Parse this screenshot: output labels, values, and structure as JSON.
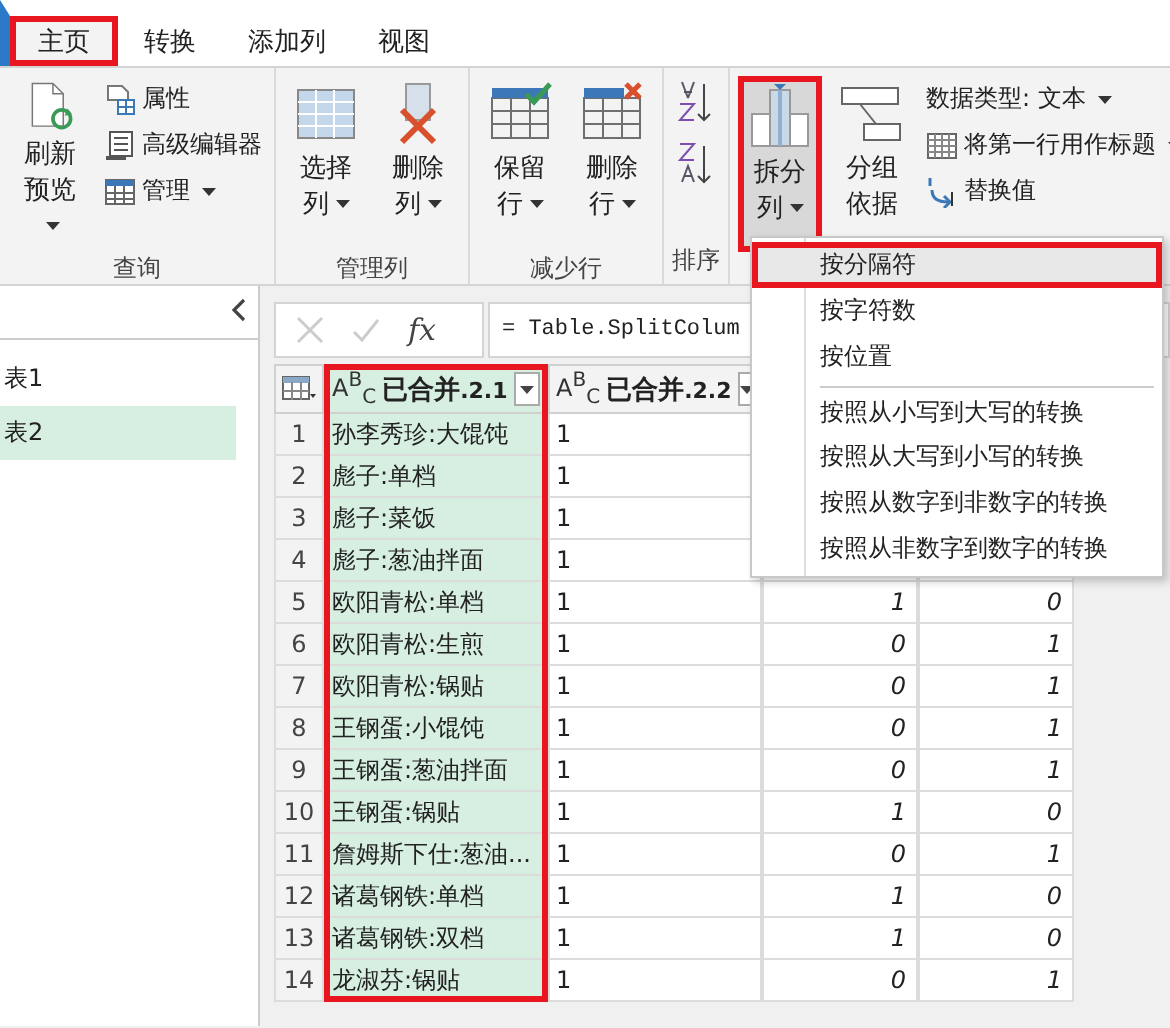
{
  "tabs": [
    {
      "label": "主页",
      "selected": true,
      "highlighted": true
    },
    {
      "label": "转换",
      "selected": false,
      "highlighted": false
    },
    {
      "label": "添加列",
      "selected": false,
      "highlighted": false
    },
    {
      "label": "视图",
      "selected": false,
      "highlighted": false
    }
  ],
  "ribbon": {
    "groups": [
      {
        "label": "查询",
        "items": [
          {
            "kind": "large",
            "lines": [
              "刷新",
              "预览"
            ],
            "dropdown": true,
            "pressed": false,
            "highlighted": false
          },
          {
            "kind": "small",
            "label": "属性",
            "dropdown": false
          },
          {
            "kind": "small",
            "label": "高级编辑器",
            "dropdown": false
          },
          {
            "kind": "small",
            "label": "管理",
            "dropdown": true
          }
        ]
      },
      {
        "label": "管理列",
        "items": [
          {
            "kind": "large",
            "lines": [
              "选择",
              "列"
            ],
            "dropdown": true,
            "pressed": false,
            "highlighted": false
          },
          {
            "kind": "large",
            "lines": [
              "删除",
              "列"
            ],
            "dropdown": true,
            "pressed": false,
            "highlighted": false
          }
        ]
      },
      {
        "label": "减少行",
        "items": [
          {
            "kind": "large",
            "lines": [
              "保留",
              "行"
            ],
            "dropdown": true,
            "pressed": false,
            "highlighted": false
          },
          {
            "kind": "large",
            "lines": [
              "删除",
              "行"
            ],
            "dropdown": true,
            "pressed": false,
            "highlighted": false
          }
        ]
      },
      {
        "label": "排序",
        "items": [
          {
            "kind": "icon"
          },
          {
            "kind": "icon"
          }
        ]
      },
      {
        "items": [
          {
            "kind": "large",
            "lines": [
              "拆分",
              "列"
            ],
            "dropdown": true,
            "pressed": true,
            "highlighted": true
          },
          {
            "kind": "large",
            "lines": [
              "分组",
              "依据"
            ],
            "dropdown": false,
            "pressed": false,
            "highlighted": false
          },
          {
            "kind": "small",
            "label": "数据类型: 文本",
            "dropdown": true
          },
          {
            "kind": "small",
            "label": "将第一行用作标题",
            "dropdown": true
          },
          {
            "kind": "small",
            "label": "替换值",
            "dropdown": false
          }
        ]
      }
    ]
  },
  "queries": {
    "items": [
      {
        "label": "表1",
        "selected": false
      },
      {
        "label": "表2",
        "selected": true
      }
    ]
  },
  "formula_bar": {
    "fx": "fx",
    "formula": "= Table.SplitColum"
  },
  "table": {
    "columns": [
      {
        "type": "A$^{B}$$_{C}$",
        "name": "已合并",
        "suffix": ".2.1",
        "selected": true,
        "highlighted": true
      },
      {
        "type": "A$^{B}$$_{C}$",
        "name": "已合并",
        "suffix": ".2.2",
        "selected": false,
        "highlighted": false
      }
    ],
    "rows": [
      {
        "num": "1",
        "cells": [
          "孙李秀珍:大馄饨",
          "1"
        ]
      },
      {
        "num": "2",
        "cells": [
          "彪子:单档",
          "1"
        ]
      },
      {
        "num": "3",
        "cells": [
          "彪子:菜饭",
          "1"
        ]
      },
      {
        "num": "4",
        "cells": [
          "彪子:葱油拌面",
          "1"
        ]
      },
      {
        "num": "5",
        "cells": [
          "欧阳青松:单档",
          "1",
          "1",
          "0"
        ]
      },
      {
        "num": "6",
        "cells": [
          "欧阳青松:生煎",
          "1",
          "0",
          "1"
        ]
      },
      {
        "num": "7",
        "cells": [
          "欧阳青松:锅贴",
          "1",
          "0",
          "1"
        ]
      },
      {
        "num": "8",
        "cells": [
          "王钢蛋:小馄饨",
          "1",
          "0",
          "1"
        ]
      },
      {
        "num": "9",
        "cells": [
          "王钢蛋:葱油拌面",
          "1",
          "0",
          "1"
        ]
      },
      {
        "num": "10",
        "cells": [
          "王钢蛋:锅贴",
          "1",
          "1",
          "0"
        ]
      },
      {
        "num": "11",
        "cells": [
          "詹姆斯下仕:葱油...",
          "1",
          "0",
          "1"
        ]
      },
      {
        "num": "12",
        "cells": [
          "诸葛钢铁:单档",
          "1",
          "1",
          "0"
        ]
      },
      {
        "num": "13",
        "cells": [
          "诸葛钢铁:双档",
          "1",
          "1",
          "0"
        ]
      },
      {
        "num": "14",
        "cells": [
          "龙淑芬:锅贴",
          "1",
          "0",
          "1"
        ]
      }
    ]
  },
  "split_menu": {
    "items": [
      {
        "label": "按分隔符",
        "highlighted": true,
        "separator_before": false
      },
      {
        "label": "按字符数",
        "highlighted": false,
        "separator_before": false
      },
      {
        "label": "按位置",
        "highlighted": false,
        "separator_before": false
      },
      {
        "label": "按照从小写到大写的转换",
        "highlighted": false,
        "separator_before": true
      },
      {
        "label": "按照从大写到小写的转换",
        "highlighted": false,
        "separator_before": false
      },
      {
        "label": "按照从数字到非数字的转换",
        "highlighted": false,
        "separator_before": false
      },
      {
        "label": "按照从非数字到数字的转换",
        "highlighted": false,
        "separator_before": false
      }
    ]
  }
}
